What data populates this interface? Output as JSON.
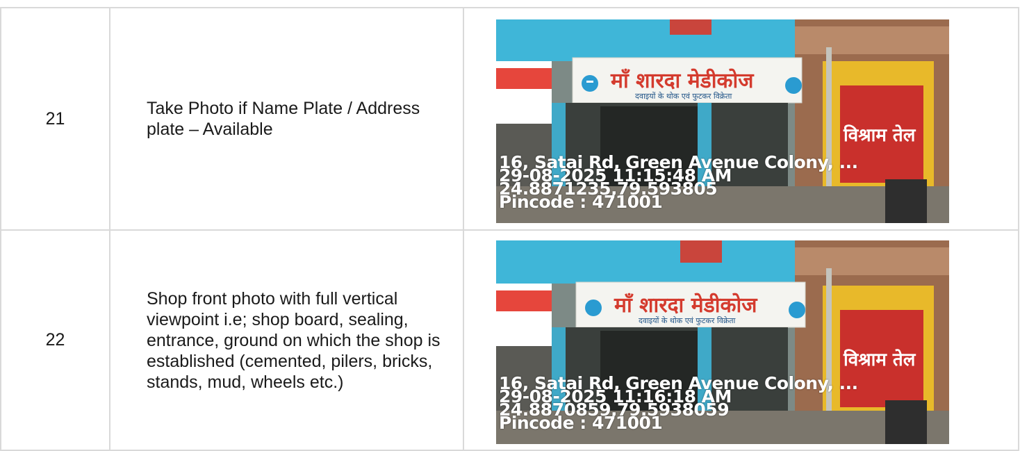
{
  "rows": [
    {
      "number": "21",
      "description": "Take Photo if Name Plate / Address plate – Available",
      "photo": {
        "shop_name": "माँ शारदा मेडीकोज",
        "shop_tagline": "दवाइयों के थोक एवं फुटकर विक्रेता",
        "wall_text": "विश्राम तेल",
        "address": "16, Satai Rd, Green Avenue Colony, ...",
        "timestamp": "29-08-2025 11:15:48 AM",
        "coords": "24.8871235,79.593805",
        "pincode": "Pincode : 471001"
      }
    },
    {
      "number": "22",
      "description": "Shop front photo with full vertical viewpoint i.e; shop board, sealing, entrance, ground on which the shop is established (cemented, pilers, bricks, stands, mud, wheels etc.)",
      "photo": {
        "shop_name": "माँ शारदा मेडीकोज",
        "shop_tagline": "दवाइयों के थोक एवं फुटकर विक्रेता",
        "wall_text": "विश्राम तेल",
        "address": "16, Satai Rd, Green Avenue Colony, ...",
        "timestamp": "29-08-2025 11:16:18 AM",
        "coords": "24.8870859,79.5938059",
        "pincode": "Pincode : 471001"
      }
    }
  ]
}
